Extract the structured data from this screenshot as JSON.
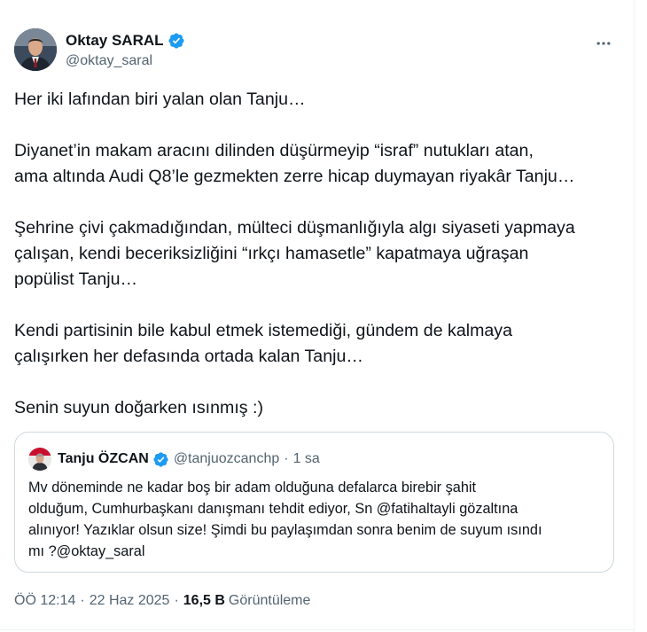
{
  "author": {
    "name": "Oktay SARAL",
    "handle": "@oktay_saral"
  },
  "icons": {
    "verified": "verified-badge-icon",
    "more": "more-options-icon"
  },
  "colors": {
    "verified": "#1d9bf0",
    "secondary_text": "#536471",
    "primary_text": "#0f1419"
  },
  "tweet": {
    "paragraphs": [
      [
        "Her iki lafından biri yalan olan Tanju…"
      ],
      [
        "Diyanet’in makam aracını dilinden düşürmeyip “israf” nutukları atan,",
        "ama altında Audi Q8’le gezmekten zerre hicap duymayan riyakâr Tanju…"
      ],
      [
        "Şehrine çivi çakmadığından, mülteci düşmanlığıyla algı siyaseti yapmaya",
        "çalışan, kendi beceriksizliğini “ırkçı hamasetle” kapatmaya uğraşan",
        "popülist Tanju…"
      ],
      [
        "Kendi partisinin bile kabul etmek istemediği, gündem de kalmaya",
        "çalışırken her defasında ortada kalan Tanju…"
      ],
      [
        "Senin suyun doğarken ısınmış :)"
      ]
    ]
  },
  "quote": {
    "name": "Tanju ÖZCAN",
    "handle": "@tanjuozcanchp",
    "separator": "·",
    "time": "1 sa",
    "lines": [
      "Mv döneminde ne kadar boş bir adam olduğuna defalarca birebir şahit",
      "olduğum, Cumhurbaşkanı danışmanı tehdit ediyor, Sn @fatihaltayli gözaltına",
      "alınıyor! Yazıklar olsun size! Şimdi bu paylaşımdan sonra benim de suyum ısındı",
      "mı ?@oktay_saral"
    ]
  },
  "meta": {
    "time": "ÖÖ 12:14",
    "separator": "·",
    "date": "22 Haz 2025",
    "views_count": "16,5 B",
    "views_label": "Görüntüleme"
  }
}
